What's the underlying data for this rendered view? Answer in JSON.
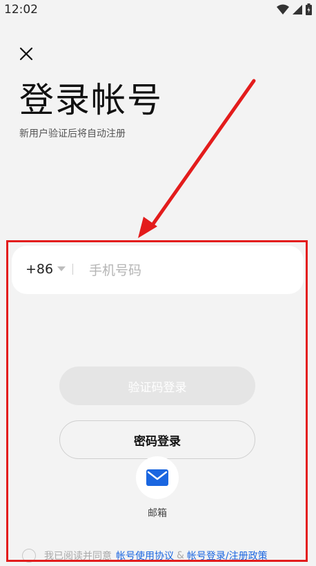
{
  "status_bar": {
    "time": "12:02"
  },
  "header": {
    "title": "登录帐号",
    "subtitle": "新用户验证后将自动注册"
  },
  "phone": {
    "country_code": "+86",
    "placeholder": "手机号码",
    "value": ""
  },
  "buttons": {
    "code_login": "验证码登录",
    "password_login": "密码登录"
  },
  "alt_login": {
    "email_label": "邮箱"
  },
  "agreement": {
    "prefix": "我已阅读并同意",
    "user_agreement": "帐号使用协议",
    "separator": "&",
    "privacy_policy": "帐号登录/注册政策"
  },
  "colors": {
    "accent": "#1a66e0",
    "annotation": "#e31c1c",
    "background": "#f3f3f3"
  }
}
